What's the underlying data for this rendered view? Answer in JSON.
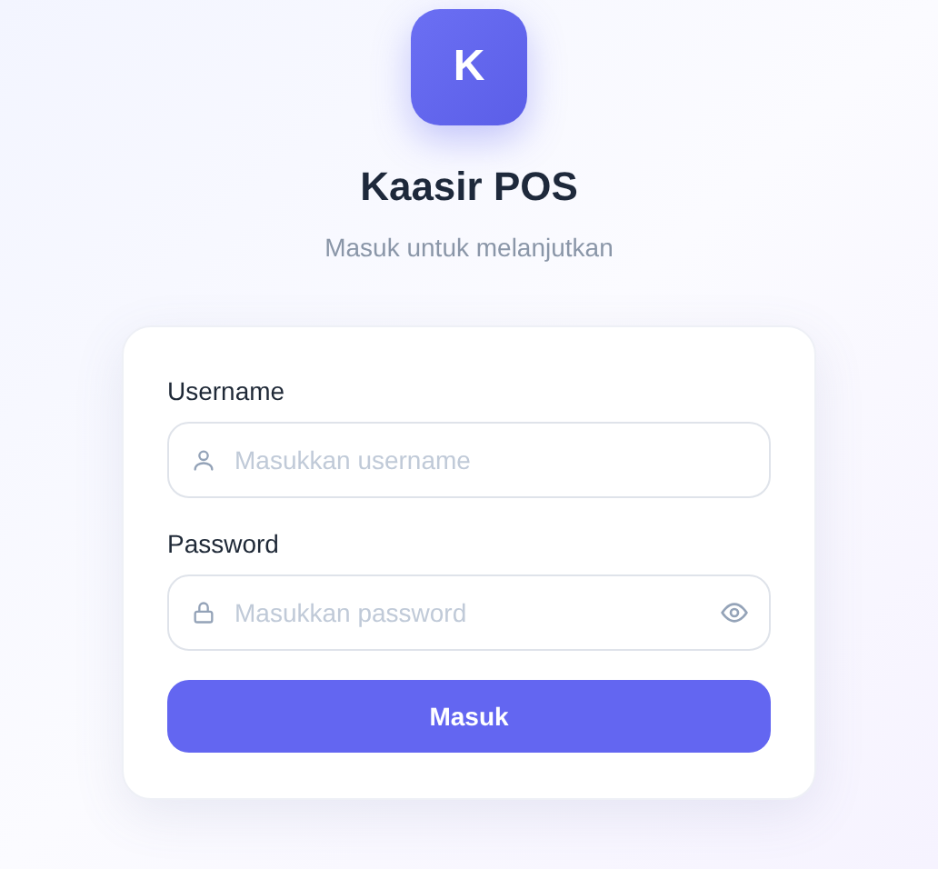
{
  "logo": {
    "letter": "K"
  },
  "title": "Kaasir POS",
  "subtitle": "Masuk untuk melanjutkan",
  "fields": [
    {
      "kind": "username",
      "label": "Username",
      "placeholder": "Masukkan username"
    },
    {
      "kind": "password",
      "label": "Password",
      "placeholder": "Masukkan password"
    }
  ],
  "submit": {
    "label": "Masuk"
  }
}
